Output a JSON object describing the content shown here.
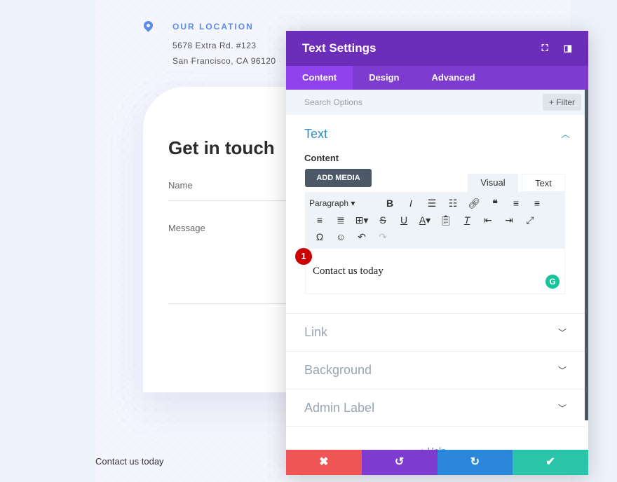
{
  "location": {
    "title": "OUR LOCATION",
    "line1": "5678 Extra Rd. #123",
    "line2": "San Francisco, CA 96120"
  },
  "form": {
    "heading": "Get in touch",
    "name_placeholder": "Name",
    "message_placeholder": "Message"
  },
  "footer_text": "Contact us today",
  "modal": {
    "title": "Text Settings",
    "tabs": [
      "Content",
      "Design",
      "Advanced"
    ],
    "search_placeholder": "Search Options",
    "filter_label": "Filter",
    "text_section": {
      "title": "Text",
      "content_label": "Content",
      "add_media": "ADD MEDIA",
      "visual_tab": "Visual",
      "text_tab": "Text",
      "format_select": "Paragraph",
      "editor_value": "Contact us today",
      "marker": "1"
    },
    "sections": [
      "Link",
      "Background",
      "Admin Label"
    ],
    "help": "Help",
    "colors": {
      "header": "#6c2eb9",
      "tabs": "#7e3bd0",
      "cancel": "#ef5555",
      "undo": "#7e3bd0",
      "redo": "#2b87da",
      "save": "#29c4a9"
    }
  }
}
